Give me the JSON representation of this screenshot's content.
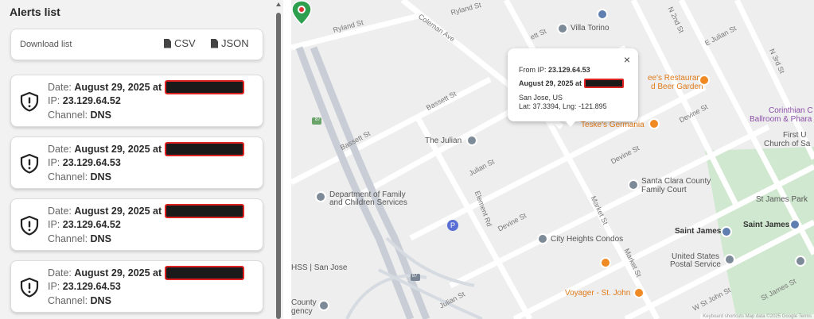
{
  "panel": {
    "title": "Alerts list",
    "download": {
      "label": "Download list",
      "csv": "CSV",
      "json": "JSON"
    }
  },
  "alerts": [
    {
      "date_prefix": "Date:",
      "date": "August 29, 2025 at",
      "ip_prefix": "IP:",
      "ip": "23.129.64.52",
      "channel_prefix": "Channel:",
      "channel": "DNS"
    },
    {
      "date_prefix": "Date:",
      "date": "August 29, 2025 at",
      "ip_prefix": "IP:",
      "ip": "23.129.64.53",
      "channel_prefix": "Channel:",
      "channel": "DNS"
    },
    {
      "date_prefix": "Date:",
      "date": "August 29, 2025 at",
      "ip_prefix": "IP:",
      "ip": "23.129.64.52",
      "channel_prefix": "Channel:",
      "channel": "DNS"
    },
    {
      "date_prefix": "Date:",
      "date": "August 29, 2025 at",
      "ip_prefix": "IP:",
      "ip": "23.129.64.53",
      "channel_prefix": "Channel:",
      "channel": "DNS"
    }
  ],
  "popup": {
    "from_prefix": "From IP:",
    "from_ip": "23.129.64.53",
    "date": "August 29, 2025 at",
    "location": "San Jose, US",
    "coords": "Lat: 37.3394, Lng: -121.895",
    "close": "×"
  },
  "map": {
    "pois": {
      "villa_torino": "Villa Torino",
      "restaurant_1": "ee's Restaurant",
      "restaurant_2": "d Beer Garden",
      "teskes": "Teske's Germania",
      "the_julian": "The Julian",
      "dept_family_1": "Department of Family",
      "dept_family_2": "and Children Services",
      "santa_clara_1": "Santa Clara County",
      "santa_clara_2": "Family Court",
      "city_heights": "City Heights Condos",
      "saint_james": "Saint James",
      "saint_james_2": "Saint James",
      "st_james_park": "St James Park",
      "us_postal_1": "United States",
      "us_postal_2": "Postal Service",
      "voyager": "Voyager - St. John",
      "hss": "HSS | San Jose",
      "county_1": "County",
      "county_2": "gency",
      "corinthian_1": "Corinthian C",
      "corinthian_2": "Ballroom & Phara",
      "first_church_1": "First U",
      "first_church_2": "Church of Sa"
    },
    "streets": {
      "ryland_st": "Ryland St",
      "ryland_st2": "Ryland St",
      "coleman_ave": "Coleman Ave",
      "bassett_st": "Bassett St",
      "bassett_st2": "Bassett St",
      "julian_st": "Julian St",
      "julian_st2": "Julian St",
      "devine_st": "Devine St",
      "devine_st2": "Devine St",
      "devine_st3": "Devine St",
      "element_rd": "Element Rd",
      "market_st": "Market St",
      "market_st2": "Market St",
      "n_2nd_st": "N 2nd St",
      "n_3rd_st": "N 3rd St",
      "e_julian_st": "E Julian St",
      "w_st_john_st": "W St John St",
      "st_james_st": "St James St",
      "route_87": "87",
      "route_87b": "87",
      "parking": "P",
      "ett_st": "ett St"
    },
    "attribution": "Keyboard shortcuts   Map data ©2025 Google   Terms"
  }
}
